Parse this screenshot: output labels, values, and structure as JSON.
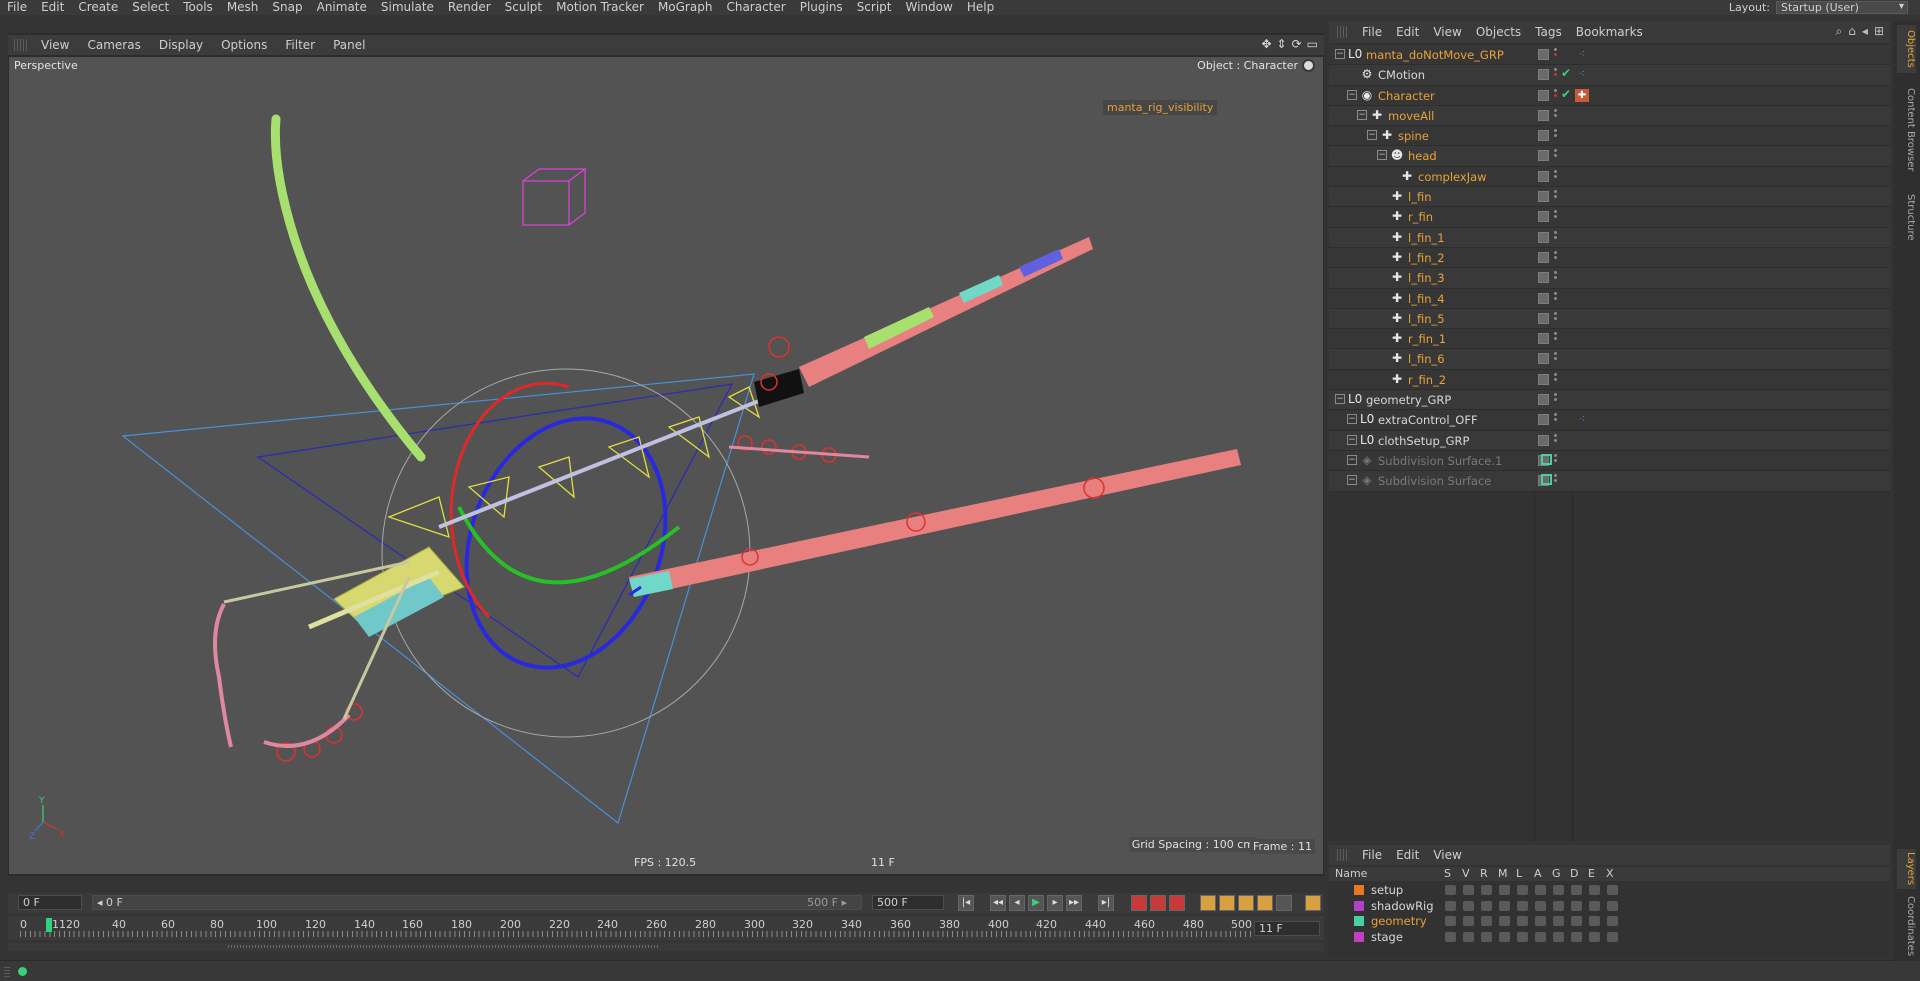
{
  "menubar": {
    "items": [
      "File",
      "Edit",
      "Create",
      "Select",
      "Tools",
      "Mesh",
      "Snap",
      "Animate",
      "Simulate",
      "Render",
      "Sculpt",
      "Motion Tracker",
      "MoGraph",
      "Character",
      "Plugins",
      "Script",
      "Window",
      "Help"
    ],
    "layout_label": "Layout:",
    "layout_value": "Startup (User)"
  },
  "viewport": {
    "menu": [
      "View",
      "Cameras",
      "Display",
      "Options",
      "Filter",
      "Panel"
    ],
    "label": "Perspective",
    "object_label": "Object : Character",
    "rig_tag": "manta_rig_visibility",
    "fps": "FPS : 120.5",
    "frame_center": "11 F",
    "grid_spacing": "Grid Spacing : 100 cm",
    "frame_right": "Frame : 11",
    "axis": {
      "x": "X",
      "y": "Y",
      "z": "Z"
    }
  },
  "timeline": {
    "start": "0 F",
    "range_left": "◂ 0 F",
    "range_right": "500 F ▸",
    "end": "500 F",
    "current": "11 F",
    "ruler": [
      "0",
      "1120",
      "40",
      "60",
      "80",
      "100",
      "120",
      "140",
      "160",
      "180",
      "200",
      "220",
      "240",
      "260",
      "280",
      "300",
      "320",
      "340",
      "360",
      "380",
      "400",
      "420",
      "440",
      "460",
      "480",
      "500"
    ],
    "buttons": [
      "|◂",
      "◂◂",
      "◂",
      "▶",
      "▸",
      "▸▸",
      "▸|"
    ]
  },
  "object_manager": {
    "menu": [
      "File",
      "Edit",
      "View",
      "Objects",
      "Tags",
      "Bookmarks"
    ],
    "rows": [
      {
        "name": "manta_doNotMove_GRP",
        "color": "#e8a23a"
      },
      {
        "name": "CMotion",
        "color": "#d8d8d8"
      },
      {
        "name": "Character",
        "color": "#e8a23a"
      },
      {
        "name": "moveAll",
        "color": "#e8a23a"
      },
      {
        "name": "spine",
        "color": "#e8a23a"
      },
      {
        "name": "head",
        "color": "#e8a23a"
      },
      {
        "name": "complexJaw",
        "color": "#e8a23a"
      },
      {
        "name": "l_fin",
        "color": "#e8a23a"
      },
      {
        "name": "r_fin",
        "color": "#e8a23a"
      },
      {
        "name": "l_fin_1",
        "color": "#e8a23a"
      },
      {
        "name": "l_fin_2",
        "color": "#e8a23a"
      },
      {
        "name": "l_fin_3",
        "color": "#e8a23a"
      },
      {
        "name": "l_fin_4",
        "color": "#e8a23a"
      },
      {
        "name": "l_fin_5",
        "color": "#e8a23a"
      },
      {
        "name": "r_fin_1",
        "color": "#e8a23a"
      },
      {
        "name": "l_fin_6",
        "color": "#e8a23a"
      },
      {
        "name": "r_fin_2",
        "color": "#e8a23a"
      },
      {
        "name": "geometry_GRP",
        "color": "#d8d8d8"
      },
      {
        "name": "extraControl_OFF",
        "color": "#d8d8d8"
      },
      {
        "name": "clothSetup_GRP",
        "color": "#d8d8d8"
      },
      {
        "name": "Subdivision Surface.1",
        "color": "#7a7a7a"
      },
      {
        "name": "Subdivision Surface",
        "color": "#7a7a7a"
      }
    ]
  },
  "dock_tabs": [
    "Objects",
    "Content Browser",
    "Structure"
  ],
  "dock_tabs_lower": [
    "Layers",
    "Coordinates"
  ],
  "layer_manager": {
    "menu": [
      "File",
      "Edit",
      "View"
    ],
    "headers": [
      "Name",
      "S",
      "V",
      "R",
      "M",
      "L",
      "A",
      "G",
      "D",
      "E",
      "X"
    ],
    "layers": [
      {
        "name": "setup",
        "swatch": "#e8781e",
        "color": "#d8d8d8"
      },
      {
        "name": "shadowRig",
        "swatch": "#b040c8",
        "color": "#d8d8d8"
      },
      {
        "name": "geometry",
        "swatch": "#4ad0a0",
        "color": "#e8a23a"
      },
      {
        "name": "stage",
        "swatch": "#c040c0",
        "color": "#d8d8d8"
      }
    ]
  },
  "colors": {
    "accent": "#e8a23a",
    "playhead": "#31d07d"
  }
}
